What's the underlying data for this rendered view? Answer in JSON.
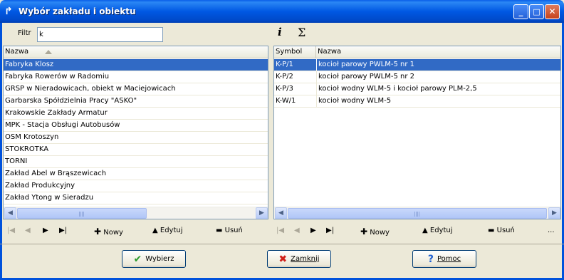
{
  "window": {
    "title": "Wybór zakładu i obiektu",
    "minimize": "_",
    "maximize": "□",
    "close": "✕"
  },
  "filter": {
    "label": "Filtr",
    "value": "k"
  },
  "toolbar": {
    "info": "i",
    "sum": "Σ"
  },
  "left_grid": {
    "columns": [
      "Nazwa"
    ],
    "rows": [
      "Fabryka Klosz",
      "Fabryka Rowerów w Radomiu",
      "GRSP w Nieradowicach, obiekt w Maciejowicach",
      "Garbarska Spółdzielnia Pracy \"ASKO\"",
      "Krakowskie Zakłady Armatur",
      "MPK - Stacja Obsługi Autobusów",
      "OSM Krotoszyn",
      "STOKROTKA",
      "TORNI",
      "Zakład Abel w Brąszewicach",
      "Zakład Produkcyjny",
      "Zakład Ytong w Sieradzu"
    ],
    "selected_index": 0
  },
  "right_grid": {
    "columns": [
      "Symbol",
      "Nazwa"
    ],
    "rows": [
      [
        "K-P/1",
        "kocioł parowy PWLM-5 nr 1"
      ],
      [
        "K-P/2",
        "kocioł parowy PWLM-5 nr 2"
      ],
      [
        "K-P/3",
        "kocioł wodny WLM-5 i kocioł parowy PLM-2,5"
      ],
      [
        "K-W/1",
        "kocioł wodny WLM-5"
      ]
    ],
    "selected_index": 0
  },
  "nav": {
    "first": "|◀",
    "prev": "◀",
    "next": "▶",
    "last": "▶|",
    "new": "Nowy",
    "edit": "Edytuj",
    "delete": "Usuń",
    "more": "..."
  },
  "buttons": {
    "select": "Wybierz",
    "close": "Zamknij",
    "help": "Pomoc"
  },
  "colors": {
    "selection": "#316ac5",
    "titlebar": "#0058e3",
    "dialog_bg": "#ece9d8"
  }
}
